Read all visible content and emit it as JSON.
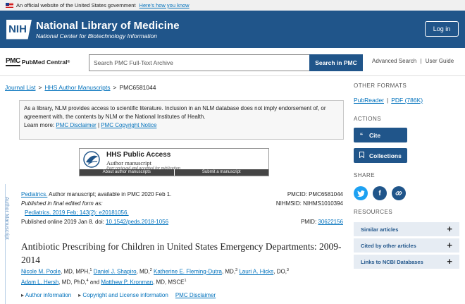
{
  "gov_banner": {
    "text": "An official website of the United States government",
    "link": "Here's how you know"
  },
  "header": {
    "logo_text": "NIH",
    "title": "National Library of Medicine",
    "subtitle": "National Center for Biotechnology Information",
    "login_label": "Log in"
  },
  "pmc_bar": {
    "logo_mark": "PMC",
    "logo_text": "PubMed Central",
    "logo_reg": "®",
    "search_placeholder": "Search PMC Full-Text Archive",
    "search_button": "Search in PMC",
    "advanced_search": "Advanced Search",
    "separator": "|",
    "user_guide": "User Guide"
  },
  "breadcrumb": {
    "items": [
      "Journal List",
      "HHS Author Manuscripts",
      "PMC6581044"
    ],
    "sep": ">"
  },
  "disclaimer": {
    "text": "As a library, NLM provides access to scientific literature. Inclusion in an NLM database does not imply endorsement of, or agreement with, the contents by NLM or the National Institutes of Health.",
    "learn_more": "Learn more:",
    "link1": "PMC Disclaimer",
    "sep": "|",
    "link2": "PMC Copyright Notice"
  },
  "hhs": {
    "title": "HHS Public Access",
    "subtitle": "Author manuscript",
    "subtitle2": "Peer reviewed and accepted for publication",
    "link1": "About author manuscripts",
    "link2": "Submit a manuscript"
  },
  "side_tag": "Author Manuscript",
  "meta": {
    "journal": "Pediatrics.",
    "availability": " Author manuscript; available in PMC 2020 Feb 1.",
    "final_form": "Published in final edited form as:",
    "citation": "Pediatrics. 2019 Feb; 143(2): e20181056.",
    "online_prefix": "Published online 2019 Jan 8. doi: ",
    "doi": "10.1542/peds.2018-1056",
    "pmcid": "PMCID: PMC6581044",
    "nihmsid": "NIHMSID: NIHMS1010394",
    "pmid_label": "PMID: ",
    "pmid": "30622156"
  },
  "article": {
    "title": "Antibiotic Prescribing for Children in United States Emergency Departments: 2009-2014"
  },
  "authors": [
    {
      "name": "Nicole M. Poole",
      "cred": ", MD, MPH,",
      "sup": "1"
    },
    {
      "name": "Daniel J. Shapiro",
      "cred": ", MD,",
      "sup": "2"
    },
    {
      "name": "Katherine E. Fleming-Dutra",
      "cred": ", MD,",
      "sup": "3"
    },
    {
      "name": "Lauri A. Hicks",
      "cred": ", DO,",
      "sup": "3"
    },
    {
      "name": "Adam L. Hersh",
      "cred": ", MD, PhD,",
      "sup": "4"
    },
    {
      "name": "Matthew P. Kronman",
      "cred": ", MD, MSCE",
      "sup": "1"
    }
  ],
  "authors_and": " and ",
  "info_links": {
    "author_info": "Author information",
    "copyright": "Copyright and License information",
    "pmc_disclaimer": "PMC Disclaimer",
    "arrow": "▸"
  },
  "sidebar": {
    "other_formats": "OTHER FORMATS",
    "pubreader": "PubReader",
    "sep": "|",
    "pdf": "PDF (786K)",
    "actions": "ACTIONS",
    "cite": "Cite",
    "collections": "Collections",
    "share": "SHARE",
    "resources": "RESOURCES",
    "res_items": [
      "Similar articles",
      "Cited by other articles",
      "Links to NCBI Databases"
    ]
  },
  "colors": {
    "brand": "#20558a",
    "link": "#0071bc",
    "twitter": "#1da1f2",
    "facebook": "#20558a",
    "link_share": "#20558a"
  },
  "icons": {
    "cite": "quote-icon",
    "collections": "bookmark-icon",
    "twitter": "twitter-icon",
    "facebook": "facebook-icon",
    "share_link": "link-icon"
  }
}
